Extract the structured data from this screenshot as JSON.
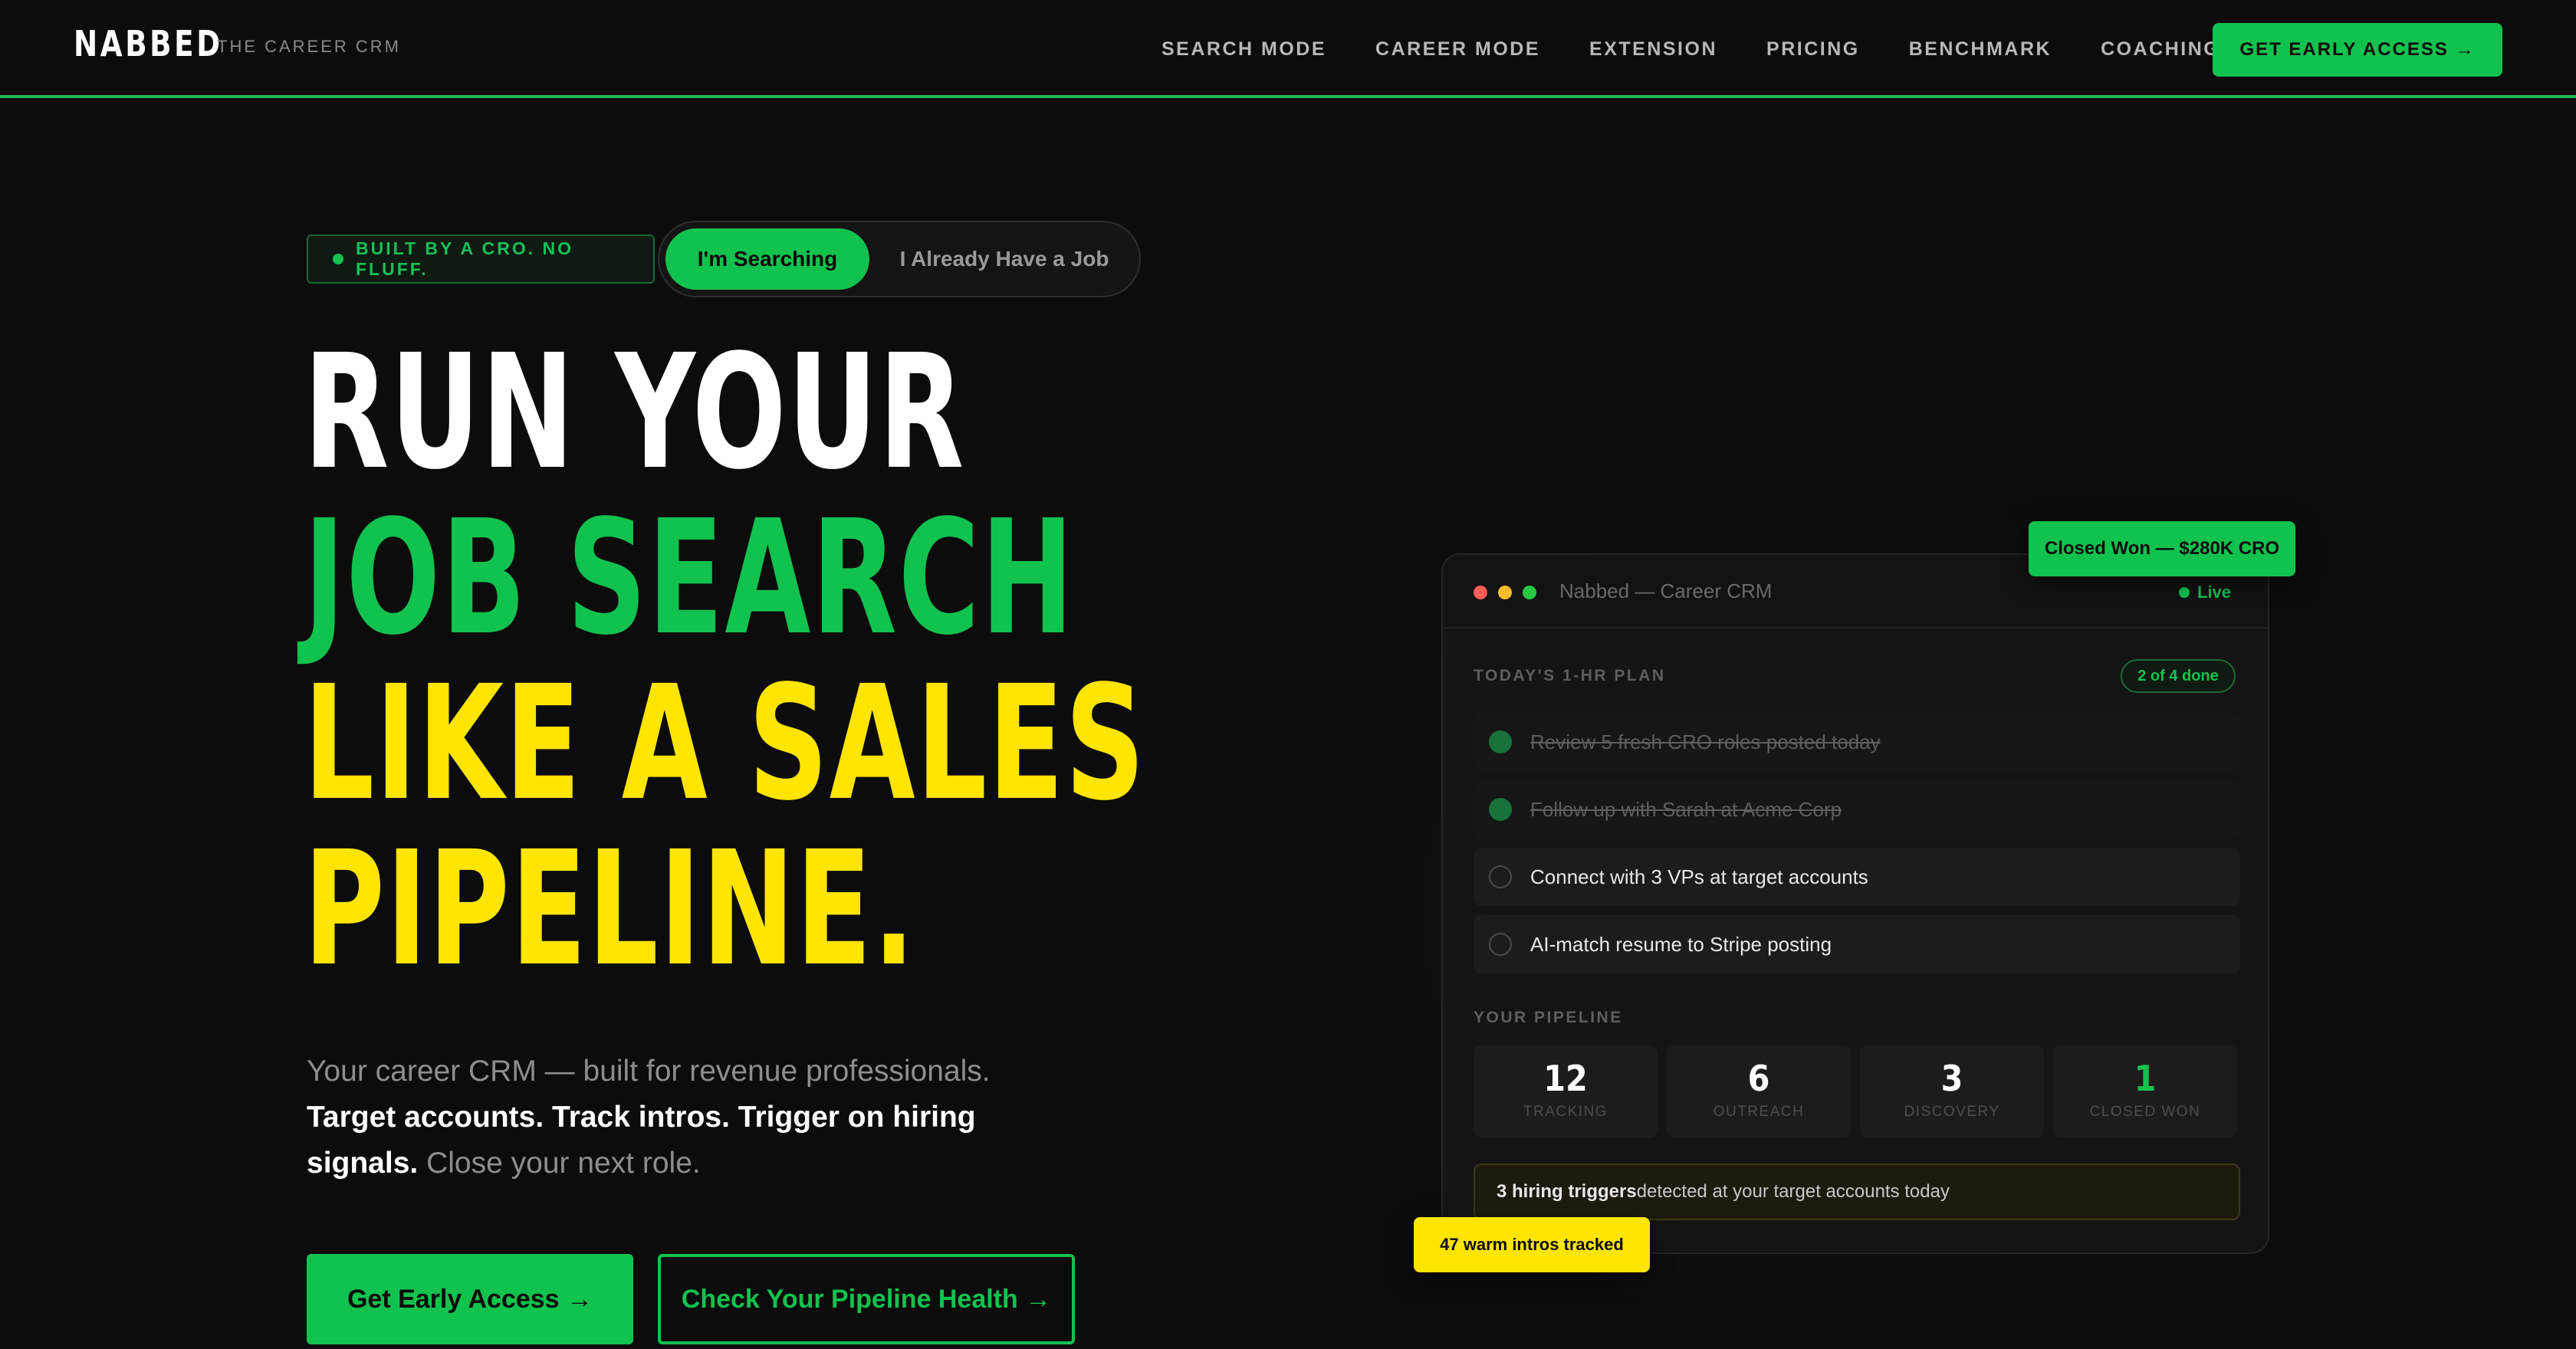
{
  "nav": {
    "logo": "NABBED",
    "tagline": "THE CAREER CRM",
    "links": [
      "SEARCH MODE",
      "CAREER MODE",
      "EXTENSION",
      "PRICING",
      "BENCHMARK",
      "COACHING"
    ],
    "cta": "GET EARLY ACCESS →"
  },
  "hero": {
    "badge": "BUILT BY A CRO. NO FLUFF.",
    "toggle": {
      "active": "I'm Searching",
      "inactive": "I Already Have a Job"
    },
    "headline": [
      "RUN YOUR",
      "JOB SEARCH",
      "LIKE A SALES",
      "PIPELINE."
    ],
    "sub_intro": "Your career CRM — built for revenue professionals.",
    "sub_bold": "Target accounts. Track intros. Trigger on hiring signals.",
    "sub_outro": "Close your next role.",
    "cta_primary": "Get Early Access →",
    "cta_secondary": "Check Your Pipeline Health →"
  },
  "card": {
    "title": "Nabbed — Career CRM",
    "live": "Live",
    "plan_label": "TODAY'S 1-HR PLAN",
    "plan_progress": "2 of 4 done",
    "tasks": [
      {
        "text": "Review 5 fresh CRO roles posted today",
        "done": true
      },
      {
        "text": "Follow up with Sarah at Acme Corp",
        "done": true
      },
      {
        "text": "Connect with 3 VPs at target accounts",
        "done": false
      },
      {
        "text": "AI-match resume to Stripe posting",
        "done": false
      }
    ],
    "pipeline_label": "YOUR PIPELINE",
    "pipeline": [
      {
        "value": "12",
        "label": "TRACKING"
      },
      {
        "value": "6",
        "label": "OUTREACH"
      },
      {
        "value": "3",
        "label": "DISCOVERY"
      },
      {
        "value": "1",
        "label": "CLOSED WON"
      }
    ],
    "trigger_bold": "3 hiring triggers",
    "trigger_rest": " detected at your target accounts today"
  },
  "floats": {
    "closed_won": "Closed Won — $280K CRO",
    "warm_intros": "47 warm intros tracked"
  },
  "colors": {
    "accent_green": "#12c24e",
    "accent_yellow": "#ffe500",
    "background": "#0c0c0c"
  }
}
